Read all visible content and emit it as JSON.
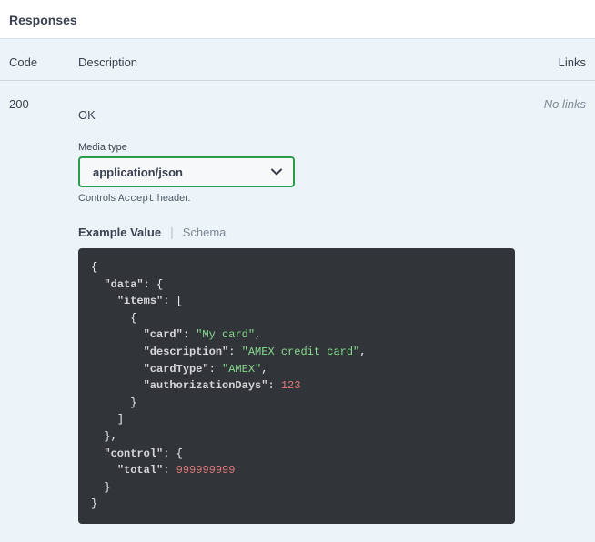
{
  "section_title": "Responses",
  "headers": {
    "code": "Code",
    "description": "Description",
    "links": "Links"
  },
  "row": {
    "code": "200",
    "description_text": "OK",
    "no_links": "No links"
  },
  "media": {
    "label": "Media type",
    "selected": "application/json",
    "hint_prefix": "Controls ",
    "hint_code": "Accept",
    "hint_suffix": " header."
  },
  "tabs": {
    "example": "Example Value",
    "schema": "Schema"
  },
  "example_json": {
    "data": {
      "items": [
        {
          "card": "My card",
          "description": "AMEX credit card",
          "cardType": "AMEX",
          "authorizationDays": 123
        }
      ]
    },
    "control": {
      "total": 999999999
    }
  }
}
